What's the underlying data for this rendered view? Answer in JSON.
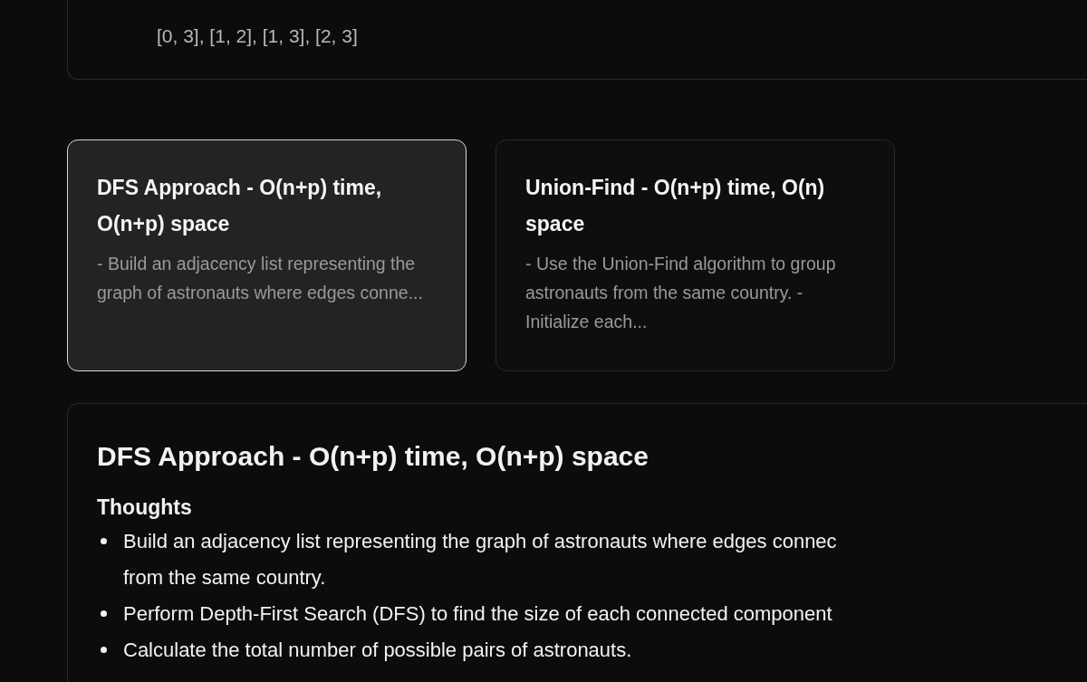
{
  "example": {
    "text": "[0, 3], [1, 2], [1, 3], [2, 3]"
  },
  "approaches": [
    {
      "title": "DFS Approach - O(n+p) time, O(n+p) space",
      "summary": "- Build an adjacency list representing the graph of astronauts where edges conne...",
      "selected": true
    },
    {
      "title": "Union-Find - O(n+p) time, O(n) space",
      "summary": "- Use the Union-Find algorithm to group astronauts from the same country. - Initialize each...",
      "selected": false
    }
  ],
  "detail": {
    "title": "DFS Approach - O(n+p) time, O(n+p) space",
    "section": "Thoughts",
    "bullets": [
      {
        "lines": [
          "Build an adjacency list representing the graph of astronauts where edges connec",
          "from the same country."
        ]
      },
      {
        "lines": [
          "Perform Depth-First Search (DFS) to find the size of each connected component"
        ]
      },
      {
        "lines": [
          "Calculate the total number of possible pairs of astronauts."
        ]
      }
    ]
  }
}
